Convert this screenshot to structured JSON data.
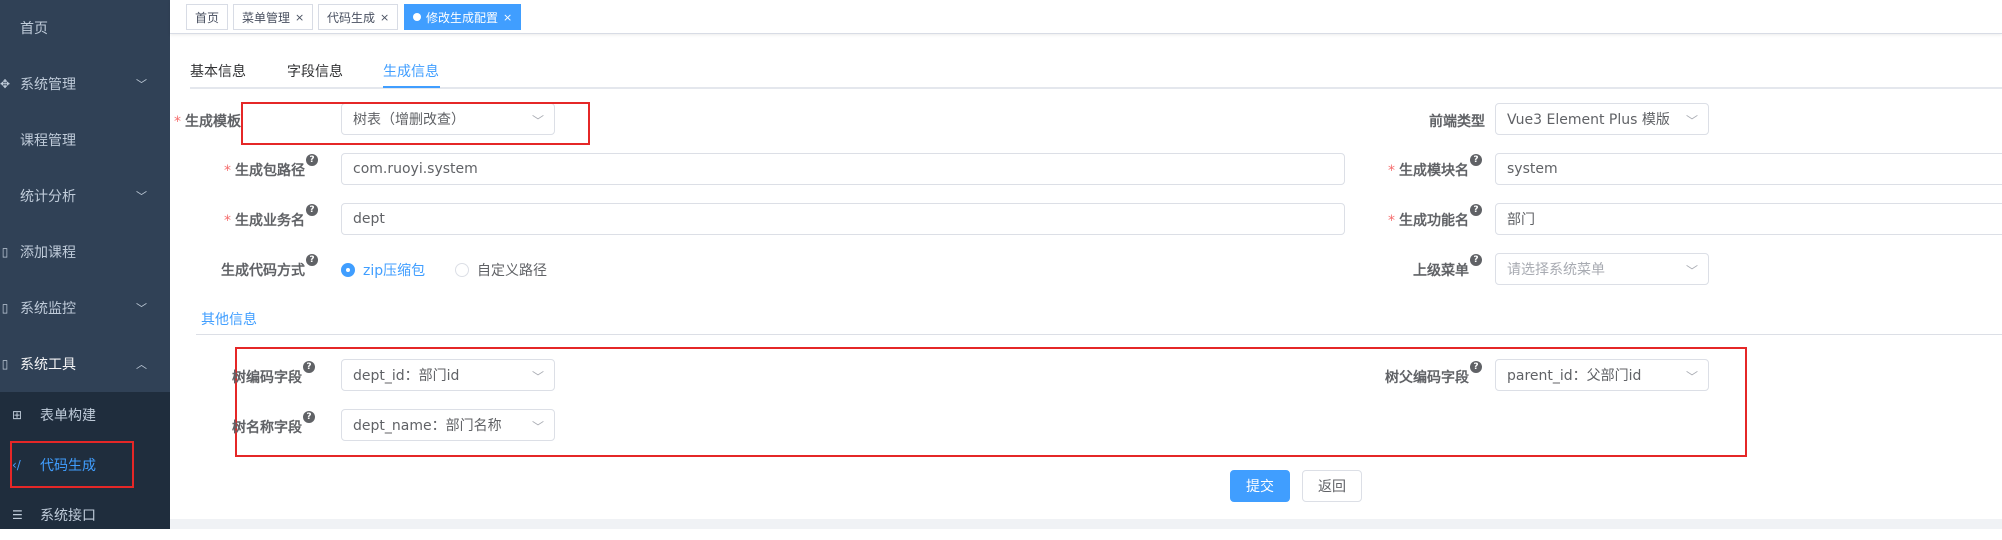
{
  "sidebar": {
    "items": [
      {
        "icon": "home-icon",
        "label": "首页"
      },
      {
        "icon": "gear-icon",
        "label": "系统管理",
        "chevron": "chevron-down-icon"
      },
      {
        "icon": "",
        "label": "课程管理"
      },
      {
        "icon": "",
        "label": "统计分析",
        "chevron": "chevron-down-icon"
      },
      {
        "icon": "add-icon",
        "label": "添加课程"
      },
      {
        "icon": "monitor-icon",
        "label": "系统监控",
        "chevron": "chevron-down-icon"
      },
      {
        "icon": "tool-icon",
        "label": "系统工具",
        "chevron": "chevron-up-icon"
      }
    ],
    "subitems": [
      {
        "icon": "table-icon",
        "label": "表单构建"
      },
      {
        "icon": "code-icon",
        "label": "代码生成",
        "active": true
      },
      {
        "icon": "sliders-icon",
        "label": "系统接口"
      }
    ]
  },
  "tags": [
    {
      "label": "首页"
    },
    {
      "label": "菜单管理",
      "close": "×"
    },
    {
      "label": "代码生成",
      "close": "×"
    },
    {
      "label": "修改生成配置",
      "close": "×",
      "active": true
    }
  ],
  "tabs": [
    "基本信息",
    "字段信息",
    "生成信息"
  ],
  "active_tab": "生成信息",
  "form": {
    "tpl_label": "生成模板",
    "tpl_value": "树表（增删改查）",
    "frontend_label": "前端类型",
    "frontend_value": "Vue3 Element Plus 模版",
    "package_label": "生成包路径",
    "package_value": "com.ruoyi.system",
    "module_label": "生成模块名",
    "module_value": "system",
    "business_label": "生成业务名",
    "business_value": "dept",
    "function_label": "生成功能名",
    "function_value": "部门",
    "gentype_label": "生成代码方式",
    "gentype_opt1": "zip压缩包",
    "gentype_opt2": "自定义路径",
    "parentmenu_label": "上级菜单",
    "parentmenu_placeholder": "请选择系统菜单"
  },
  "other": {
    "title": "其他信息",
    "treecode_label": "树编码字段",
    "treecode_value": "dept_id：部门id",
    "treeparent_label": "树父编码字段",
    "treeparent_value": "parent_id：父部门id",
    "treename_label": "树名称字段",
    "treename_value": "dept_name：部门名称"
  },
  "buttons": {
    "submit": "提交",
    "back": "返回"
  },
  "colors": {
    "sidebar_bg": "#304156",
    "submenu_bg": "#1f2d3d",
    "primary": "#409eff",
    "highlight_red": "#e52727",
    "required": "#f56c6c"
  }
}
